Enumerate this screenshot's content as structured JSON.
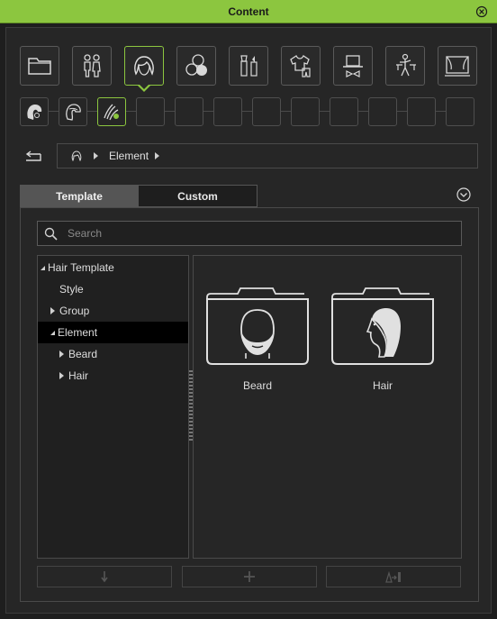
{
  "window": {
    "title": "Content"
  },
  "categories": [
    {
      "name": "folder-icon",
      "active": false
    },
    {
      "name": "characters-icon",
      "active": false
    },
    {
      "name": "hair-icon",
      "active": true
    },
    {
      "name": "materials-icon",
      "active": false
    },
    {
      "name": "makeup-icon",
      "active": false
    },
    {
      "name": "clothing-icon",
      "active": false
    },
    {
      "name": "accessory-icon",
      "active": false
    },
    {
      "name": "motion-icon",
      "active": false
    },
    {
      "name": "stage-icon",
      "active": false
    }
  ],
  "subcategories": [
    {
      "name": "hair-template-icon",
      "active": false
    },
    {
      "name": "hair-preset-icon",
      "active": false
    },
    {
      "name": "hair-element-icon",
      "active": true
    },
    {
      "name": "empty-slot",
      "active": false
    }
  ],
  "breadcrumb": {
    "label": "Element"
  },
  "tabs": {
    "template": "Template",
    "custom": "Custom"
  },
  "search": {
    "placeholder": "Search",
    "value": ""
  },
  "tree": {
    "root": "Hair Template",
    "style": "Style",
    "group": "Group",
    "element": "Element",
    "beard": "Beard",
    "hair": "Hair"
  },
  "items": [
    {
      "label": "Beard",
      "icon": "beard-folder-icon"
    },
    {
      "label": "Hair",
      "icon": "hair-folder-icon"
    }
  ],
  "colors": {
    "accent": "#8cc63f",
    "background": "#262626",
    "selected_row": "#000000"
  }
}
